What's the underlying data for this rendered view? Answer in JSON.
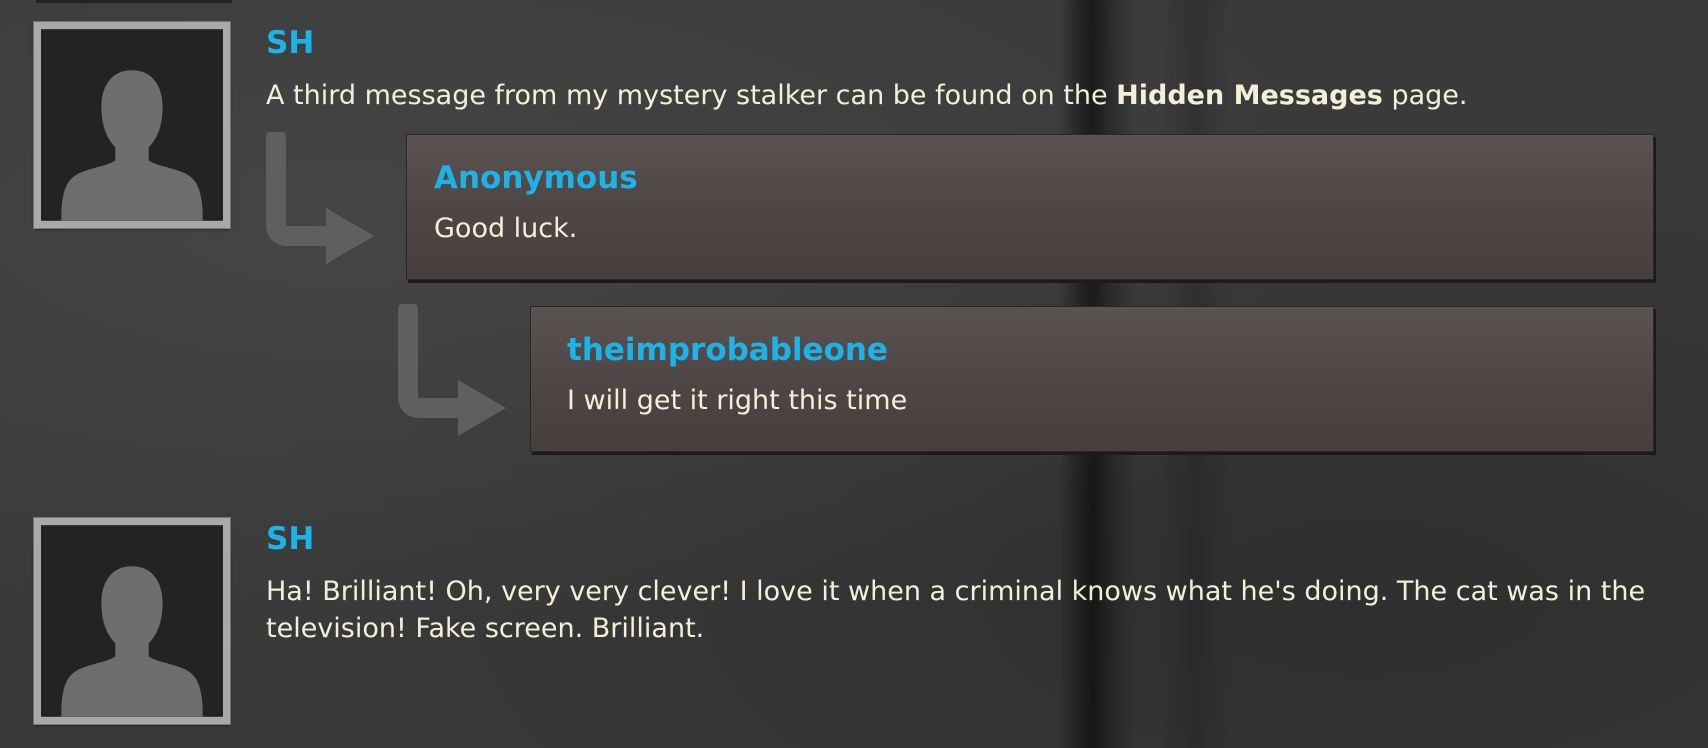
{
  "comments": [
    {
      "author": "SH",
      "text_before": "A third message from my mystery stalker can be found on the ",
      "text_link": "Hidden Messages",
      "text_after": " page.",
      "replies": [
        {
          "author": "Anonymous",
          "text": "Good luck."
        },
        {
          "author": "theimprobableone",
          "text": "I will get it right this time"
        }
      ]
    },
    {
      "author": "SH",
      "text": "Ha! Brilliant! Oh, very very clever! I love it when a criminal knows what he's doing. The cat was in the television! Fake screen. Brilliant."
    }
  ],
  "icons": {
    "avatar": "person-silhouette-icon",
    "reply_arrow": "reply-arrow-icon"
  },
  "colors": {
    "author": "#1cb3e8",
    "text": "#f4f0d8",
    "reply_box": "#524a48",
    "background": "#3a3a3a"
  }
}
